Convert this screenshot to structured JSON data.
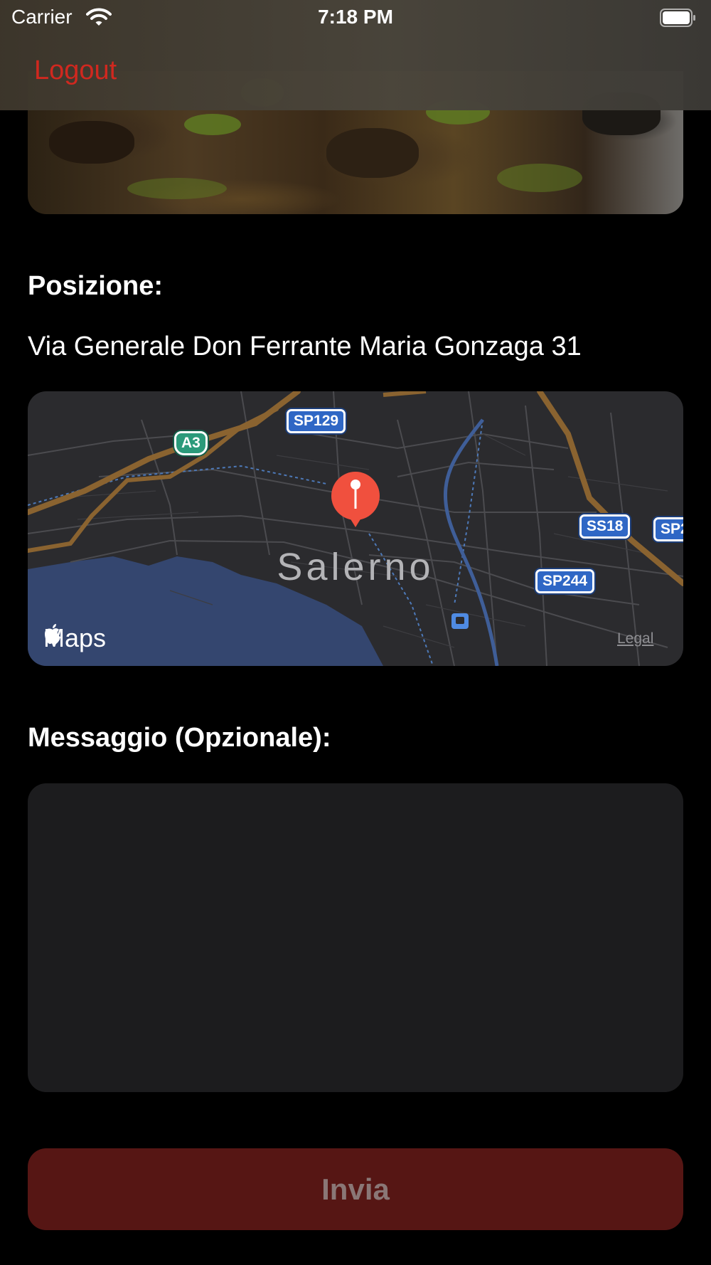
{
  "status_bar": {
    "carrier": "Carrier",
    "time": "7:18 PM",
    "wifi_icon": "wifi-icon",
    "battery_icon": "battery-icon"
  },
  "nav": {
    "logout_label": "Logout",
    "accent_color": "#d0281f"
  },
  "hero": {
    "image": "rocky-landscape-photo"
  },
  "position": {
    "label": "Posizione:",
    "address": "Via Generale Don Ferrante Maria Gonzaga 31"
  },
  "map": {
    "city": "Salerno",
    "shields": {
      "a3": "A3",
      "sp129": "SP129",
      "ss18": "SS18",
      "sp_partial": "SP2",
      "sp244": "SP244"
    },
    "logo_text": "Maps",
    "legal": "Legal",
    "pin_icon": "map-pin-icon"
  },
  "message": {
    "label": "Messaggio (Opzionale):",
    "value": ""
  },
  "send": {
    "label": "Invia",
    "color": "#561614"
  }
}
